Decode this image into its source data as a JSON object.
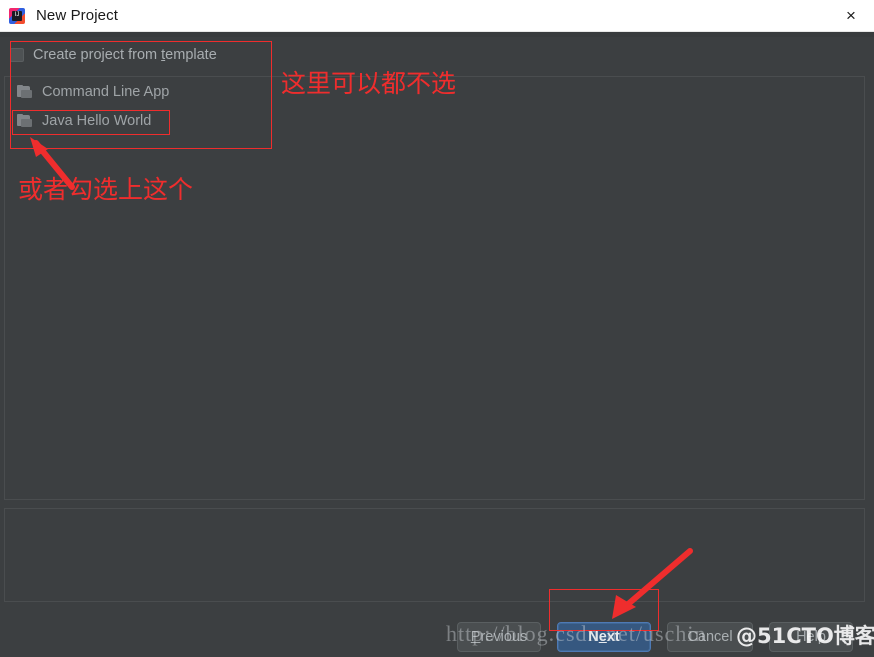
{
  "window": {
    "title": "New Project",
    "logo_icon": "intellij-idea-logo-icon",
    "close_icon": "×"
  },
  "template_checkbox": {
    "label_before": "Create project from ",
    "label_mnemonic": "t",
    "label_after": "emplate",
    "checked": false
  },
  "template_list": {
    "items": [
      {
        "label": "Command Line App",
        "icon": "folder-icon",
        "selected": false
      },
      {
        "label": "Java Hello World",
        "icon": "folder-icon",
        "selected": false
      }
    ]
  },
  "buttons": {
    "previous": {
      "label_mnemonic": "P",
      "label_after": "revious"
    },
    "next": {
      "label_before": "N",
      "label_mnemonic": "e",
      "label_after": "xt",
      "primary": true
    },
    "cancel": {
      "label": "Cancel"
    },
    "help": {
      "label": "Help"
    }
  },
  "annotations": {
    "top_note": "这里可以都不选",
    "bottom_note": "或者勾选上这个",
    "color": "#ef2d2d"
  },
  "watermarks": {
    "url": "http://blog.csdn.net/uschin",
    "brand": "@51CTO博客"
  },
  "colors": {
    "dialog_background": "#3c3f41",
    "titlebar_background": "#ffffff",
    "primary_button": "#365880",
    "annotation_red": "#ef2d2d",
    "text_muted": "#a8adb0"
  }
}
